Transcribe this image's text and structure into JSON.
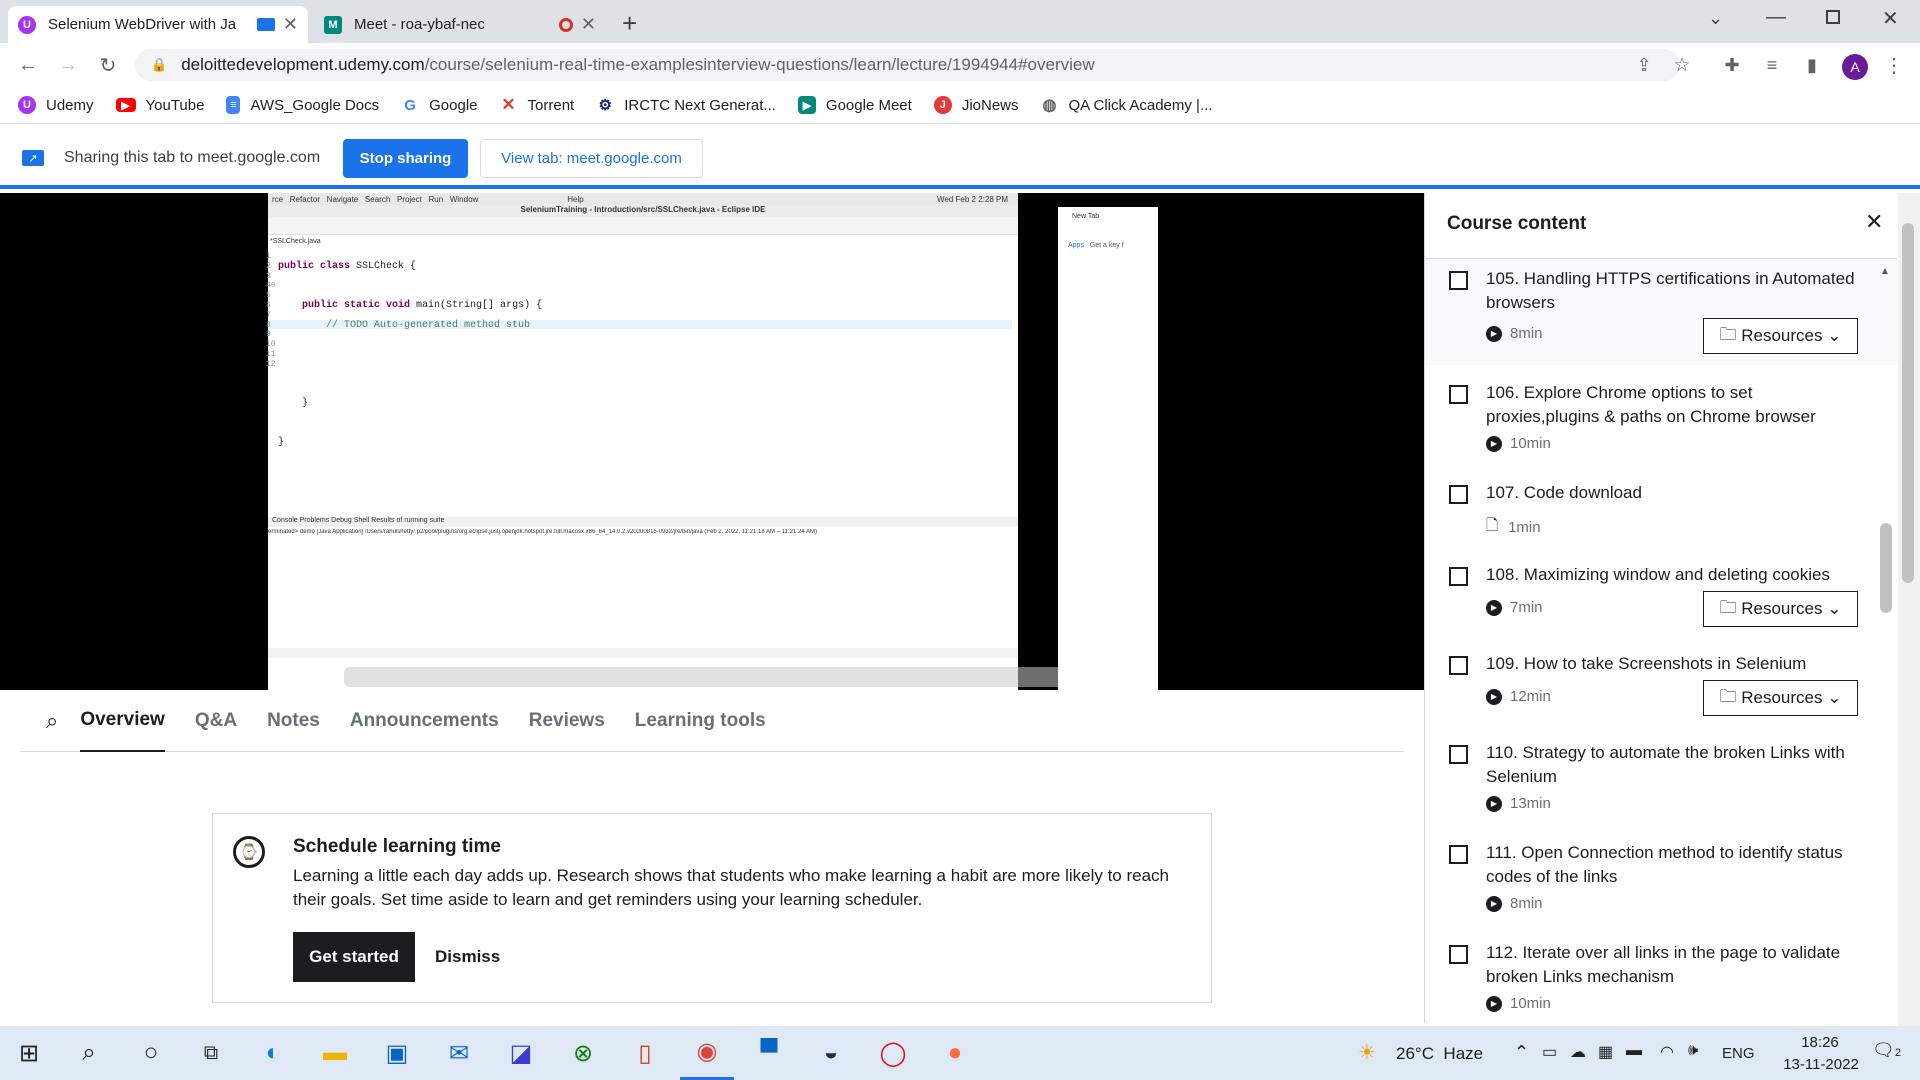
{
  "browser": {
    "tabs": [
      {
        "title": "Selenium WebDriver with Ja",
        "active": true
      },
      {
        "title": "Meet - roa-ybaf-nec",
        "active": false
      }
    ],
    "url_host": "deloittedevelopment.udemy.com",
    "url_path": "/course/selenium-real-time-examplesinterview-questions/learn/lecture/1994944#overview",
    "profile_initial": "A",
    "bookmarks": [
      "Udemy",
      "YouTube",
      "AWS_Google Docs",
      "Google",
      "Torrent",
      "IRCTC Next Generat...",
      "Google Meet",
      "JioNews",
      "QA Click Academy |..."
    ]
  },
  "share_bar": {
    "text": "Sharing this tab to meet.google.com",
    "stop_label": "Stop sharing",
    "view_label": "View tab: meet.google.com"
  },
  "video": {
    "ide_title": "SeleniumTraining - Introduction/src/SSLCheck.java - Eclipse IDE",
    "mac_menu": "rce   Refactor   Navigate   Search   Project   Run   Window                                        Help",
    "mac_clock": "Wed Feb 2  2:28 PM",
    "file_tab": "*SSLCheck.java",
    "code_lines": [
      "public class SSLCheck {",
      "",
      "    public static void main(String[] args) {",
      "        // TODO Auto-generated method stub",
      "",
      "",
      "",
      "    }",
      "",
      "}"
    ],
    "console_tabs": "Console   Problems   Debug Shell   Results of running suite",
    "console_line": "erminated> demo [Java Application] /Users/rahulshetty/.p2/pool/plugins/org.eclipse.justj.openjdk.hotspot.jre.full.macosx.x86_64_14.0.2.v20200815-0932/jre/bin/java  (Feb 2, 2022, 11:21:18 AM – 11:21:24 AM)",
    "side_tab": "New Tab",
    "side_apps": "Apps",
    "side_key": "Get a key f"
  },
  "course_tabs": [
    "Overview",
    "Q&A",
    "Notes",
    "Announcements",
    "Reviews",
    "Learning tools"
  ],
  "schedule": {
    "title": "Schedule learning time",
    "body": "Learning a little each day adds up. Research shows that students who make learning a habit are more likely to reach their goals. Set time aside to learn and get reminders using your learning scheduler.",
    "primary": "Get started",
    "secondary": "Dismiss"
  },
  "sidebar": {
    "title": "Course content",
    "lectures": [
      {
        "title": "105. Handling HTTPS certifications in Automated browsers",
        "meta": "8min",
        "type": "video",
        "resources": "Resources"
      },
      {
        "title": "106. Explore Chrome options to set proxies,plugins & paths on Chrome browser",
        "meta": "10min",
        "type": "video"
      },
      {
        "title": "107. Code download",
        "meta": "1min",
        "type": "file"
      },
      {
        "title": "108. Maximizing window and deleting cookies",
        "meta": "7min",
        "type": "video",
        "resources": "Resources"
      },
      {
        "title": "109. How to take Screenshots in Selenium",
        "meta": "12min",
        "type": "video",
        "resources": "Resources"
      },
      {
        "title": "110. Strategy to automate the broken Links with Selenium",
        "meta": "13min",
        "type": "video"
      },
      {
        "title": "111. Open Connection method to identify status codes of the links",
        "meta": "8min",
        "type": "video"
      },
      {
        "title": "112. Iterate over all links in the page to validate broken Links mechanism",
        "meta": "10min",
        "type": "video"
      }
    ]
  },
  "taskbar": {
    "weather": "26°C  Haze",
    "lang": "ENG",
    "time": "18:26",
    "date": "13-11-2022",
    "notifications": "2"
  }
}
